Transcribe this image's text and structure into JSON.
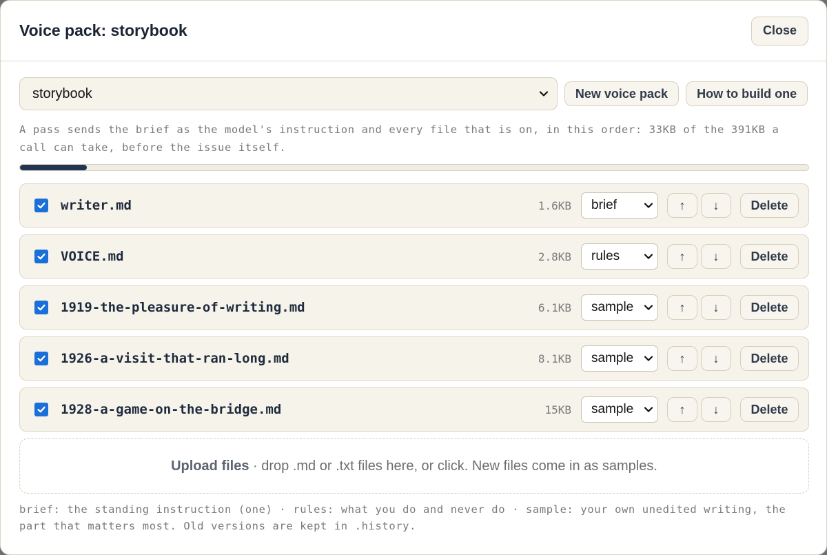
{
  "dialog": {
    "title": "Voice pack: storybook",
    "close_label": "Close"
  },
  "pack_select": {
    "selected": "storybook"
  },
  "buttons": {
    "new_pack": "New voice pack",
    "how_to": "How to build one"
  },
  "description": "A pass sends the brief as the model's instruction and every file that is on, in this order: 33KB of the 391KB a call can take, before the issue itself.",
  "usage": {
    "used_kb": 33,
    "limit_kb": 391
  },
  "files": [
    {
      "name": "writer.md",
      "size": "1.6KB",
      "role": "brief",
      "checked": true
    },
    {
      "name": "VOICE.md",
      "size": "2.8KB",
      "role": "rules",
      "checked": true
    },
    {
      "name": "1919-the-pleasure-of-writing.md",
      "size": "6.1KB",
      "role": "sample",
      "checked": true
    },
    {
      "name": "1926-a-visit-that-ran-long.md",
      "size": "8.1KB",
      "role": "sample",
      "checked": true
    },
    {
      "name": "1928-a-game-on-the-bridge.md",
      "size": "15KB",
      "role": "sample",
      "checked": true
    }
  ],
  "row_controls": {
    "up": "↑",
    "down": "↓",
    "delete": "Delete"
  },
  "upload": {
    "label": "Upload files",
    "hint": " · drop .md or .txt files here, or click. New files come in as samples."
  },
  "legend": "brief: the standing instruction (one) · rules: what you do and never do · sample: your own unedited writing, the part that matters most. Old versions are kept in .history.",
  "colors": {
    "accent": "#1f3552",
    "checkbox": "#1a6fd8",
    "row_bg": "#f6f3eb"
  }
}
